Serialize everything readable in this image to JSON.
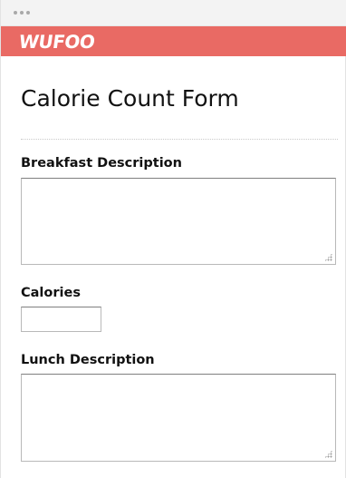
{
  "brand": {
    "logo_text": "WUFOO",
    "accent_color": "#e96a64"
  },
  "form": {
    "title": "Calorie Count Form",
    "fields": {
      "breakfast": {
        "label": "Breakfast Description",
        "value": ""
      },
      "calories": {
        "label": "Calories",
        "value": ""
      },
      "lunch": {
        "label": "Lunch Description",
        "value": ""
      }
    }
  }
}
